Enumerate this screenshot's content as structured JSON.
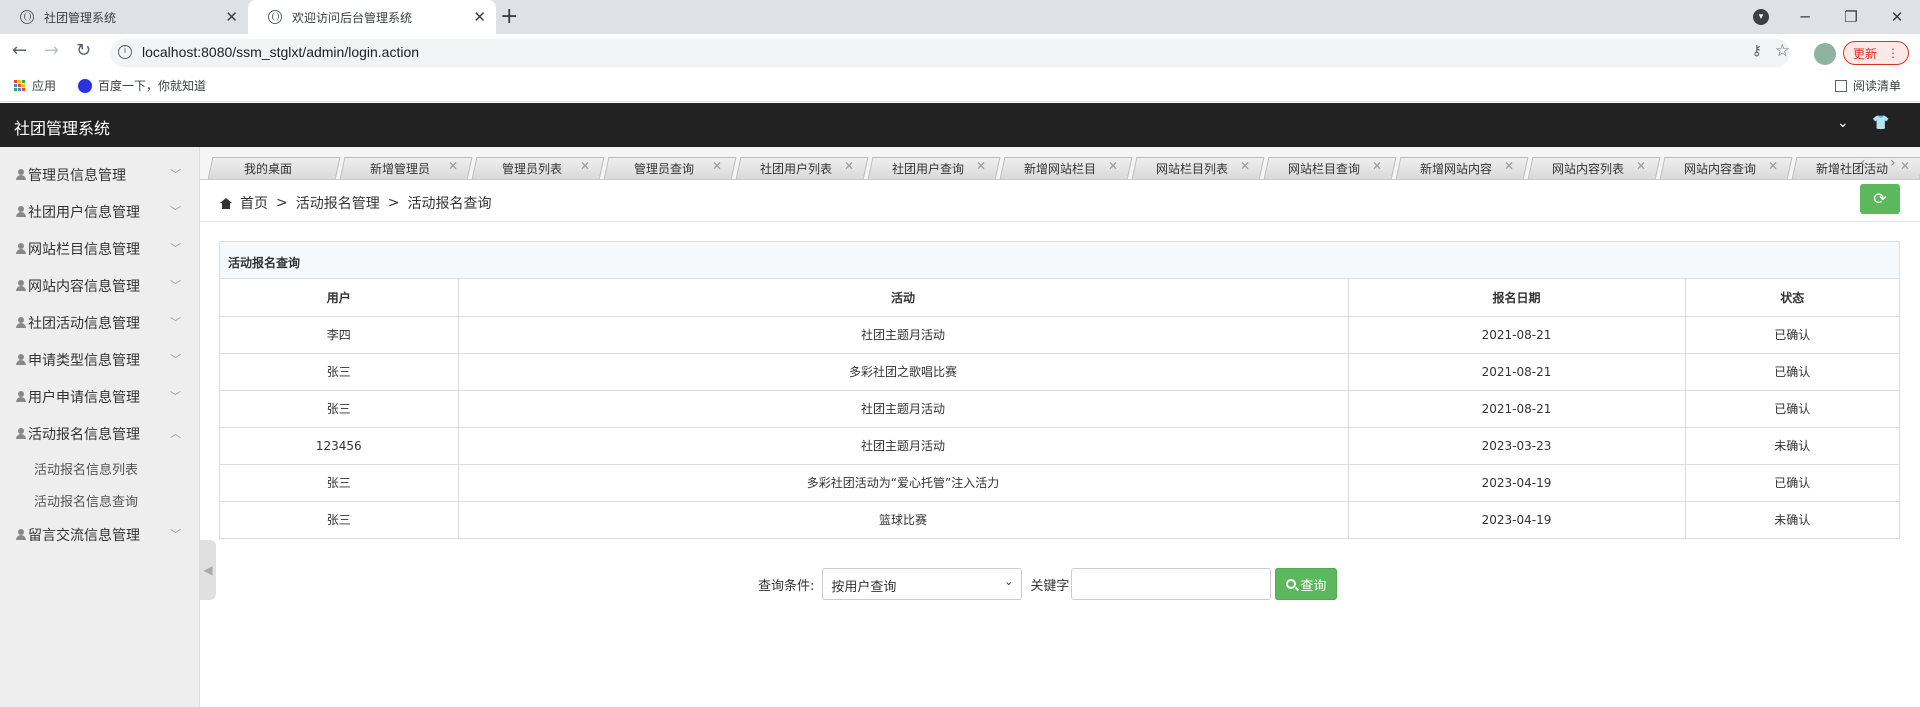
{
  "browser": {
    "tabs": [
      {
        "title": "社团管理系统",
        "close": "✕"
      },
      {
        "title": "欢迎访问后台管理系统",
        "close": "✕"
      }
    ],
    "new_tab": "+",
    "url": "localhost:8080/ssm_stglxt/admin/login.action",
    "update_label": "更新",
    "bookmarks": {
      "apps": "应用",
      "baidu": "百度一下，你就知道",
      "reading_list": "阅读清单"
    }
  },
  "app": {
    "title": "社团管理系统"
  },
  "sidebar": {
    "items": [
      {
        "label": "管理员信息管理"
      },
      {
        "label": "社团用户信息管理"
      },
      {
        "label": "网站栏目信息管理"
      },
      {
        "label": "网站内容信息管理"
      },
      {
        "label": "社团活动信息管理"
      },
      {
        "label": "申请类型信息管理"
      },
      {
        "label": "用户申请信息管理"
      },
      {
        "label": "活动报名信息管理"
      },
      {
        "label": "留言交流信息管理"
      }
    ],
    "sub_items": [
      {
        "label": "活动报名信息列表"
      },
      {
        "label": "活动报名信息查询"
      }
    ]
  },
  "page_tabs": [
    "我的桌面",
    "新增管理员",
    "管理员列表",
    "管理员查询",
    "社团用户列表",
    "社团用户查询",
    "新增网站栏目",
    "网站栏目列表",
    "网站栏目查询",
    "新增网站内容",
    "网站内容列表",
    "网站内容查询",
    "新增社团活动"
  ],
  "breadcrumb": {
    "home": "首页",
    "sep": ">",
    "level1": "活动报名管理",
    "level2": "活动报名查询"
  },
  "table": {
    "title": "活动报名查询",
    "headers": [
      "用户",
      "活动",
      "报名日期",
      "状态"
    ],
    "rows": [
      [
        "李四",
        "社团主题月活动",
        "2021-08-21",
        "已确认"
      ],
      [
        "张三",
        "多彩社团之歌唱比赛",
        "2021-08-21",
        "已确认"
      ],
      [
        "张三",
        "社团主题月活动",
        "2021-08-21",
        "已确认"
      ],
      [
        "123456",
        "社团主题月活动",
        "2023-03-23",
        "未确认"
      ],
      [
        "张三",
        "多彩社团活动为“爱心托管”注入活力",
        "2023-04-19",
        "已确认"
      ],
      [
        "张三",
        "篮球比赛",
        "2023-04-19",
        "未确认"
      ]
    ]
  },
  "search": {
    "condition_label": "查询条件:",
    "condition_value": "按用户查询",
    "keyword_label": "关键字",
    "keyword_value": "",
    "button_label": "查询"
  }
}
